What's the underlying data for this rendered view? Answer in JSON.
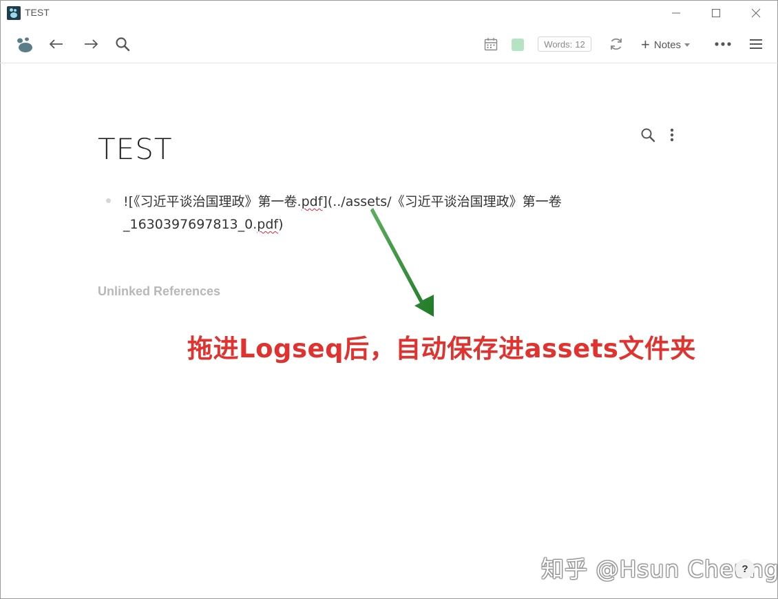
{
  "window": {
    "title": "TEST",
    "controls": {
      "minimize": "—",
      "maximize": "☐",
      "close": "✕"
    }
  },
  "toolbar": {
    "logo_icon": "logseq-logo-icon",
    "back_icon": "arrow-left-icon",
    "forward_icon": "arrow-right-icon",
    "search_icon": "search-icon",
    "calendar_icon": "calendar-icon",
    "words_label": "Words:",
    "words_count": "12",
    "sync_icon": "refresh-icon",
    "new_label": "Notes",
    "more_icon": "ellipsis-icon",
    "menu_icon": "hamburger-icon",
    "swatch_color": "#b6e3c3"
  },
  "page": {
    "title": "TEST",
    "block": {
      "part1": "![《习近平谈治国理政》第一卷.",
      "part2": "pdf",
      "part3": "](../assets/《习近平谈治国理政》第一卷",
      "part4": "_1630397697813_0.",
      "part5": "pdf",
      "part6": ")"
    },
    "unlinked_references": "Unlinked References"
  },
  "annotation": {
    "text": "拖进Logseq后，自动保存进assets文件夹",
    "color": "#e0322e",
    "arrow_color": "#2e8a32"
  },
  "watermark": "知乎 @Hsun Cheung",
  "help_label": "?"
}
